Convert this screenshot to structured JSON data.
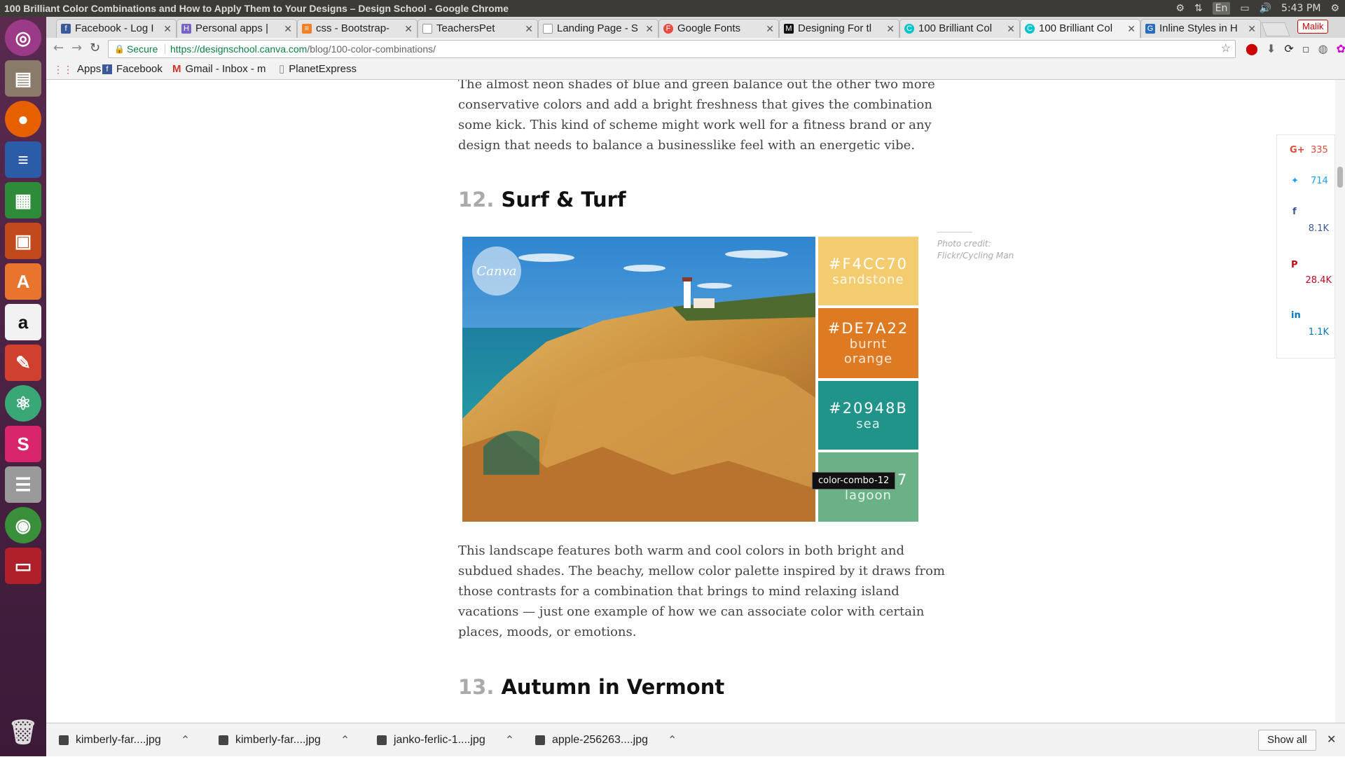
{
  "window": {
    "title": "100 Brilliant Color Combinations and How to Apply Them to Your Designs – Design School - Google Chrome"
  },
  "system_tray": {
    "lang": "En",
    "clock": "5:43 PM",
    "user": "Malik"
  },
  "tabs": [
    {
      "label": "Facebook - Log I",
      "fav_color": "#3b5998",
      "fav_glyph": "f"
    },
    {
      "label": "Personal apps | ",
      "fav_color": "#7a63c6",
      "fav_glyph": "H"
    },
    {
      "label": "css - Bootstrap-",
      "fav_color": "#f48024",
      "fav_glyph": "≡"
    },
    {
      "label": "TeachersPet",
      "fav_color": "#999999",
      "fav_glyph": ""
    },
    {
      "label": "Landing Page - S",
      "fav_color": "#999999",
      "fav_glyph": ""
    },
    {
      "label": "Google Fonts",
      "fav_color": "#e94a3f",
      "fav_glyph": "F"
    },
    {
      "label": "Designing For tl",
      "fav_color": "#111111",
      "fav_glyph": "M"
    },
    {
      "label": "100 Brilliant Col",
      "fav_color": "#00c4cc",
      "fav_glyph": "C"
    },
    {
      "label": "100 Brilliant Col",
      "fav_color": "#00c4cc",
      "fav_glyph": "C"
    },
    {
      "label": "Inline Styles in H",
      "fav_color": "#2a6ebb",
      "fav_glyph": "G"
    }
  ],
  "address": {
    "secure": "Secure",
    "host": "https://designschool.canva.com",
    "path": "/blog/100-color-combinations/"
  },
  "bookmarks": [
    {
      "label": "Apps"
    },
    {
      "label": "Facebook"
    },
    {
      "label": "Gmail - Inbox - m"
    },
    {
      "label": "PlanetExpress"
    }
  ],
  "article": {
    "intro_lines": [
      "The almost neon shades of blue and green balance out the other two more",
      "conservative colors and add a bright freshness that gives the combination",
      "some kick. This kind of scheme might work well for a fitness brand or any",
      "design that needs to balance a businesslike feel with an energetic vibe."
    ],
    "section12": {
      "number": "12.",
      "title": "Surf & Turf"
    },
    "logo": "Canva",
    "swatches": [
      {
        "hex": "#F4CC70",
        "name": "sandstone",
        "color": "#F4CC70"
      },
      {
        "hex": "#DE7A22",
        "name": "burnt orange",
        "color": "#DE7A22"
      },
      {
        "hex": "#20948B",
        "name": "sea",
        "color": "#20948B"
      },
      {
        "hex": "#6AB187",
        "name": "lagoon",
        "color": "#6AB187"
      }
    ],
    "credit": "Photo credit: Flickr/Cycling Man",
    "tooltip": "color-combo-12",
    "body_lines": [
      "This landscape features both warm and cool colors in both bright and",
      "subdued shades. The beachy, mellow color palette inspired by it draws from",
      "those contrasts for a combination that brings to mind relaxing island",
      "vacations — just one example of how we can associate color with certain",
      "places, moods, or emotions."
    ],
    "section13": {
      "number": "13.",
      "title": "Autumn in Vermont"
    }
  },
  "social": [
    {
      "icon": "google-plus-icon",
      "glyph": "G+",
      "count": "335",
      "color": "#dd4b39"
    },
    {
      "icon": "twitter-icon",
      "glyph": "🐦",
      "count": "714",
      "color": "#1da1f2"
    },
    {
      "icon": "facebook-icon",
      "glyph": "f",
      "count": "8.1K",
      "color": "#3b5998"
    },
    {
      "icon": "pinterest-icon",
      "glyph": "P",
      "count": "28.4K",
      "color": "#bd081c"
    },
    {
      "icon": "linkedin-icon",
      "glyph": "in",
      "count": "1.1K",
      "color": "#0077b5"
    }
  ],
  "downloads": [
    {
      "name": "kimberly-far....jpg"
    },
    {
      "name": "kimberly-far....jpg"
    },
    {
      "name": "janko-ferlic-1....jpg"
    },
    {
      "name": "apple-256263....jpg"
    }
  ],
  "download_bar": {
    "show_all": "Show all"
  }
}
